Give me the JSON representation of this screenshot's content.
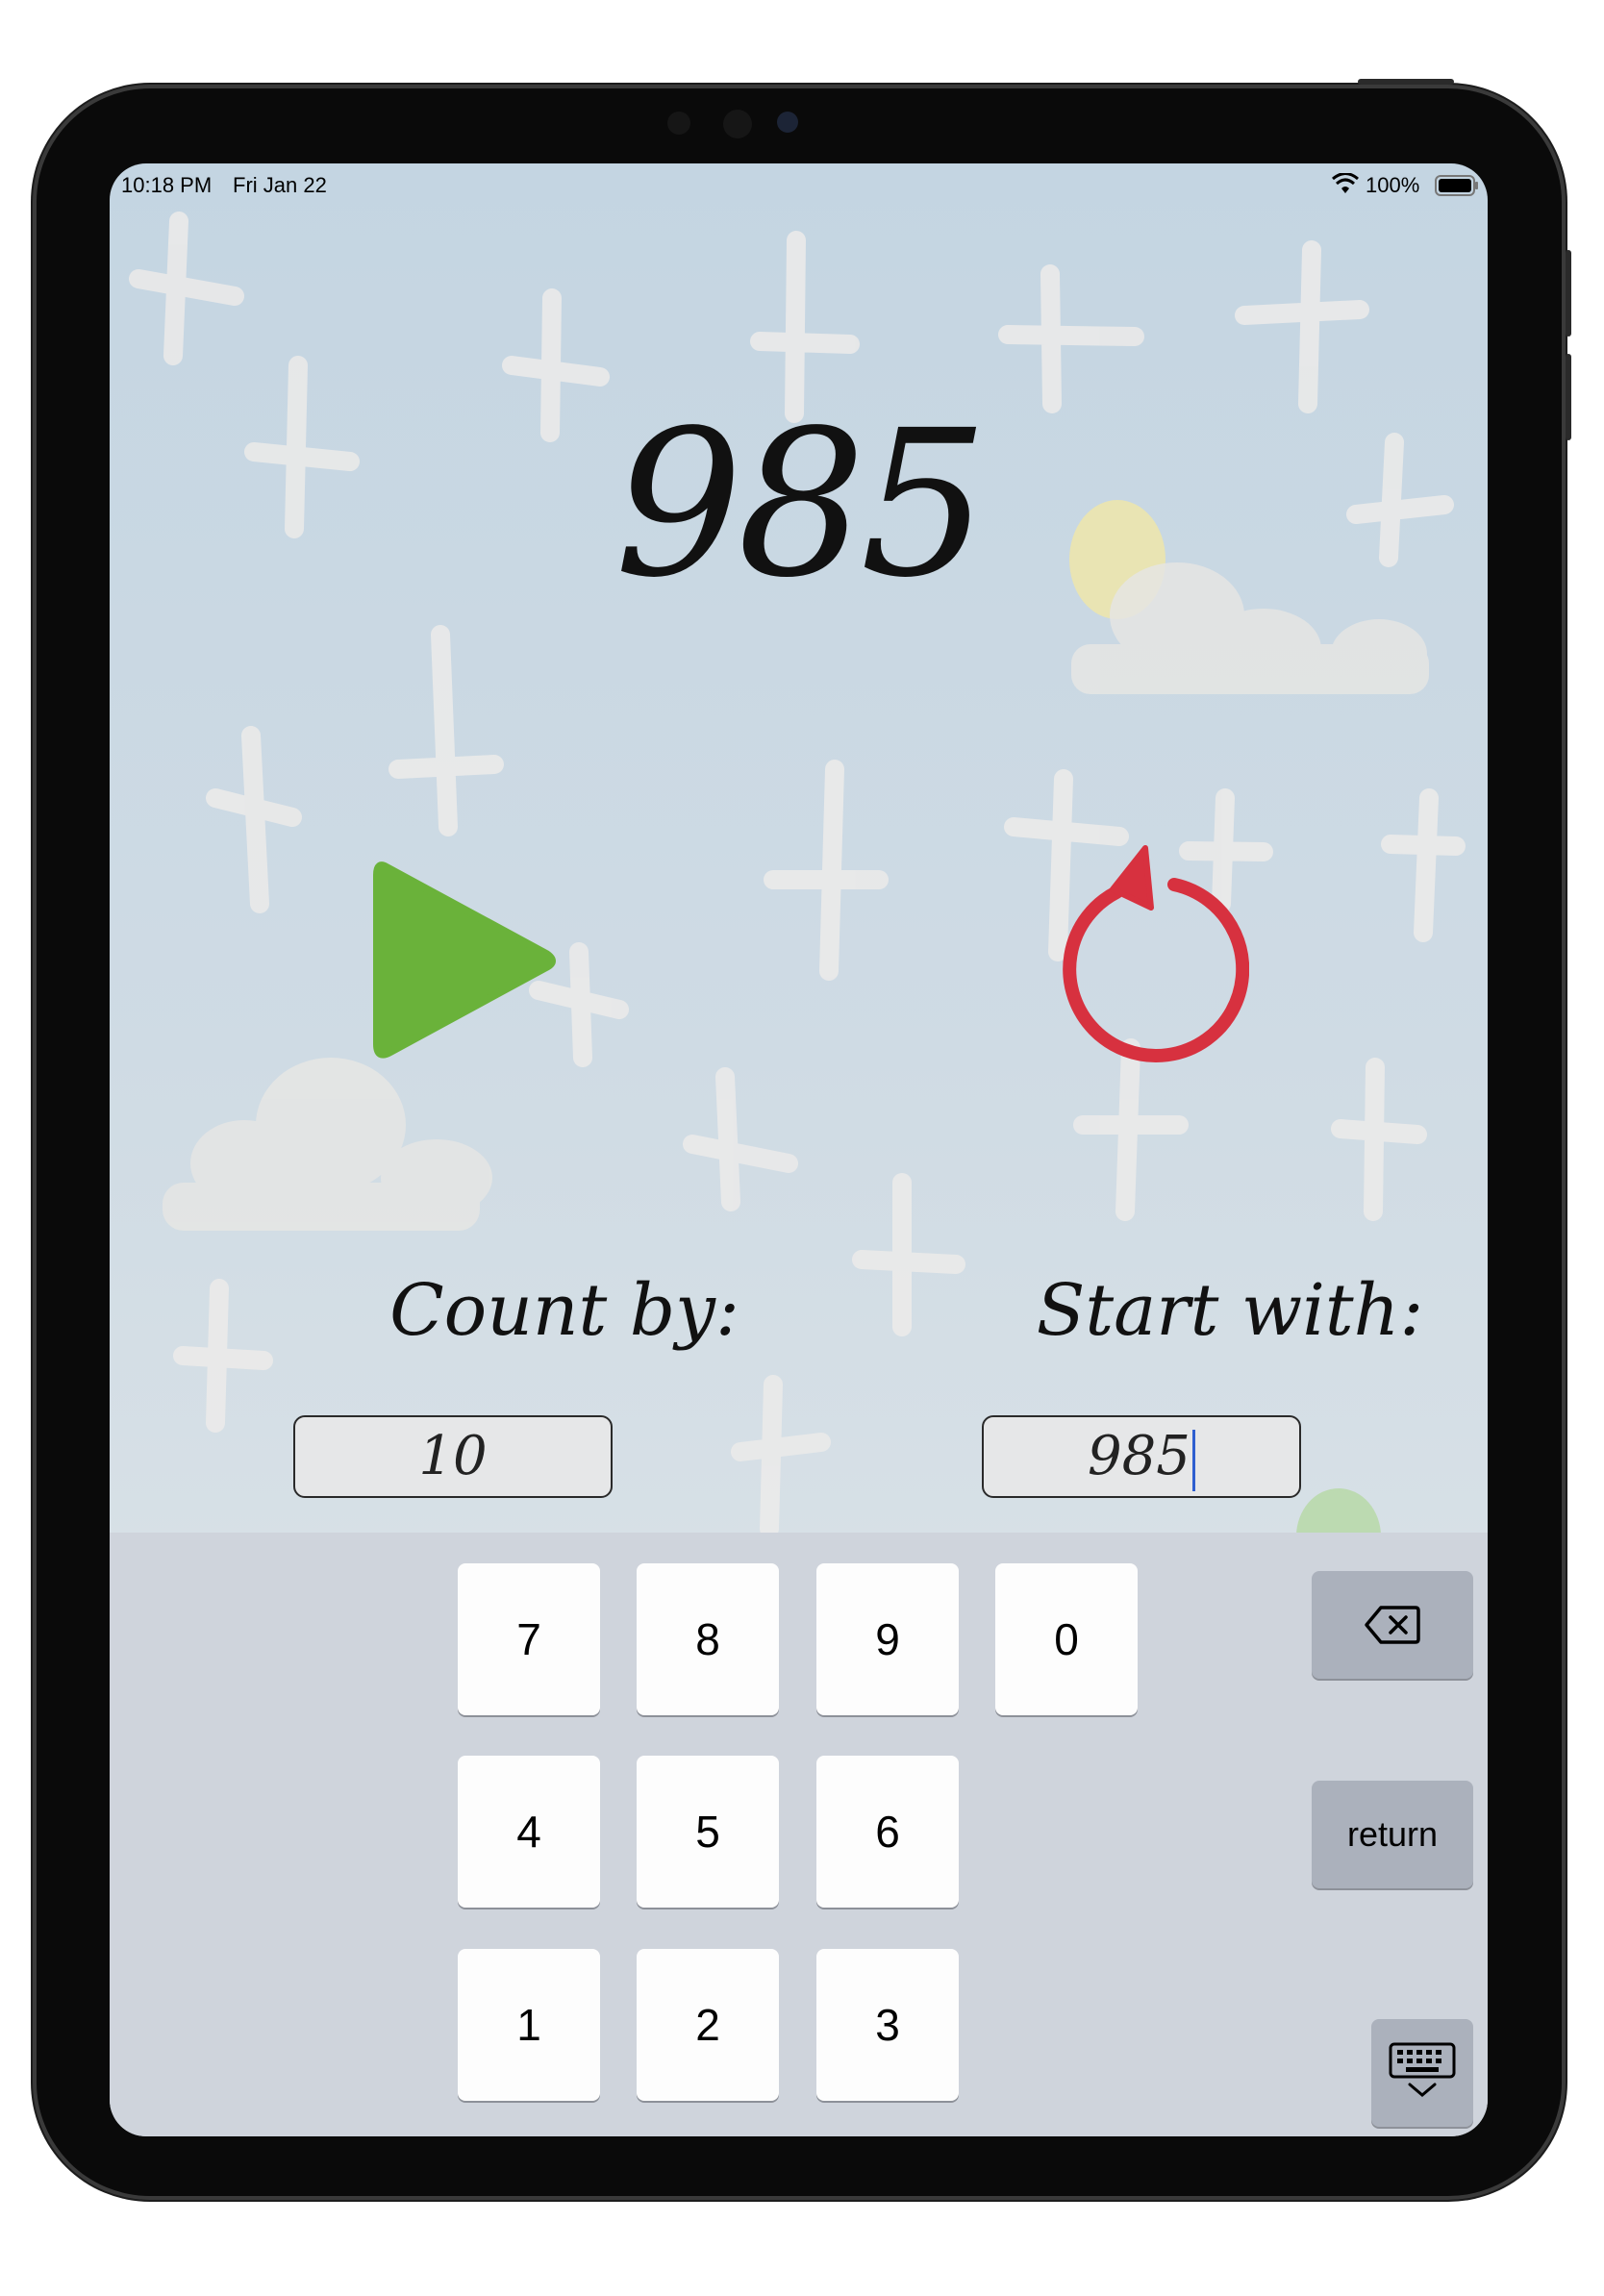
{
  "status_bar": {
    "time": "10:18 PM",
    "date": "Fri Jan 22",
    "battery": "100%"
  },
  "counter": {
    "value": "985"
  },
  "controls": {
    "play_icon": "play-icon",
    "reset_icon": "reset-icon",
    "play_color": "#6ab23a",
    "reset_color": "#d7313f"
  },
  "count_by": {
    "label": "Count by:",
    "value": "10"
  },
  "start_with": {
    "label": "Start with:",
    "value": "985"
  },
  "keyboard": {
    "row1": [
      "7",
      "8",
      "9",
      "0"
    ],
    "row2": [
      "4",
      "5",
      "6"
    ],
    "row3": [
      "1",
      "2",
      "3"
    ],
    "return_label": "return",
    "delete_icon": "backspace-icon",
    "dismiss_icon": "keyboard-dismiss-icon"
  }
}
